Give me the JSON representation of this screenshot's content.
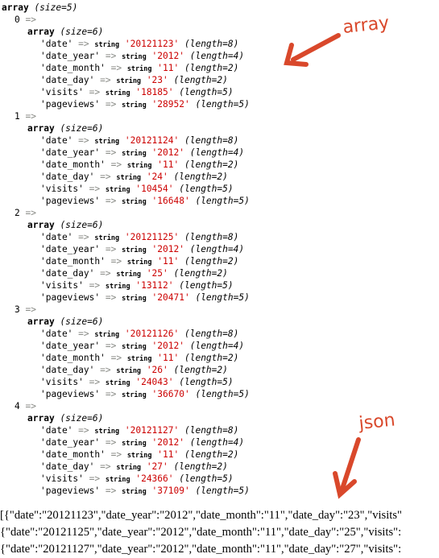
{
  "dump": {
    "keyword": "array",
    "size_label": "(size=5)",
    "entry_arrow": "=>",
    "item_arrow": "=>",
    "string_label": "string",
    "items": [
      {
        "index": "0",
        "size_label": "(size=6)",
        "fields": [
          {
            "key": "'date'",
            "value": "'20121123'",
            "length": "(length=8)"
          },
          {
            "key": "'date_year'",
            "value": "'2012'",
            "length": "(length=4)"
          },
          {
            "key": "'date_month'",
            "value": "'11'",
            "length": "(length=2)"
          },
          {
            "key": "'date_day'",
            "value": "'23'",
            "length": "(length=2)"
          },
          {
            "key": "'visits'",
            "value": "'18185'",
            "length": "(length=5)"
          },
          {
            "key": "'pageviews'",
            "value": "'28952'",
            "length": "(length=5)"
          }
        ]
      },
      {
        "index": "1",
        "size_label": "(size=6)",
        "fields": [
          {
            "key": "'date'",
            "value": "'20121124'",
            "length": "(length=8)"
          },
          {
            "key": "'date_year'",
            "value": "'2012'",
            "length": "(length=4)"
          },
          {
            "key": "'date_month'",
            "value": "'11'",
            "length": "(length=2)"
          },
          {
            "key": "'date_day'",
            "value": "'24'",
            "length": "(length=2)"
          },
          {
            "key": "'visits'",
            "value": "'10454'",
            "length": "(length=5)"
          },
          {
            "key": "'pageviews'",
            "value": "'16648'",
            "length": "(length=5)"
          }
        ]
      },
      {
        "index": "2",
        "size_label": "(size=6)",
        "fields": [
          {
            "key": "'date'",
            "value": "'20121125'",
            "length": "(length=8)"
          },
          {
            "key": "'date_year'",
            "value": "'2012'",
            "length": "(length=4)"
          },
          {
            "key": "'date_month'",
            "value": "'11'",
            "length": "(length=2)"
          },
          {
            "key": "'date_day'",
            "value": "'25'",
            "length": "(length=2)"
          },
          {
            "key": "'visits'",
            "value": "'13112'",
            "length": "(length=5)"
          },
          {
            "key": "'pageviews'",
            "value": "'20471'",
            "length": "(length=5)"
          }
        ]
      },
      {
        "index": "3",
        "size_label": "(size=6)",
        "fields": [
          {
            "key": "'date'",
            "value": "'20121126'",
            "length": "(length=8)"
          },
          {
            "key": "'date_year'",
            "value": "'2012'",
            "length": "(length=4)"
          },
          {
            "key": "'date_month'",
            "value": "'11'",
            "length": "(length=2)"
          },
          {
            "key": "'date_day'",
            "value": "'26'",
            "length": "(length=2)"
          },
          {
            "key": "'visits'",
            "value": "'24043'",
            "length": "(length=5)"
          },
          {
            "key": "'pageviews'",
            "value": "'36670'",
            "length": "(length=5)"
          }
        ]
      },
      {
        "index": "4",
        "size_label": "(size=6)",
        "fields": [
          {
            "key": "'date'",
            "value": "'20121127'",
            "length": "(length=8)"
          },
          {
            "key": "'date_year'",
            "value": "'2012'",
            "length": "(length=4)"
          },
          {
            "key": "'date_month'",
            "value": "'11'",
            "length": "(length=2)"
          },
          {
            "key": "'date_day'",
            "value": "'27'",
            "length": "(length=2)"
          },
          {
            "key": "'visits'",
            "value": "'24366'",
            "length": "(length=5)"
          },
          {
            "key": "'pageviews'",
            "value": "'37109'",
            "length": "(length=5)"
          }
        ]
      }
    ]
  },
  "annotations": {
    "array_label": "array",
    "json_label": "json",
    "color": "#d9482b"
  },
  "json_output": {
    "lines": [
      "[{\"date\":\"20121123\",\"date_year\":\"2012\",\"date_month\":\"11\",\"date_day\":\"23\",\"visits\"",
      "{\"date\":\"20121125\",\"date_year\":\"2012\",\"date_month\":\"11\",\"date_day\":\"25\",\"visits\":",
      "{\"date\":\"20121127\",\"date_year\":\"2012\",\"date_month\":\"11\",\"date_day\":\"27\",\"visits\":"
    ]
  },
  "colors": {
    "string_value": "#cc0000",
    "operator": "#888a85"
  }
}
